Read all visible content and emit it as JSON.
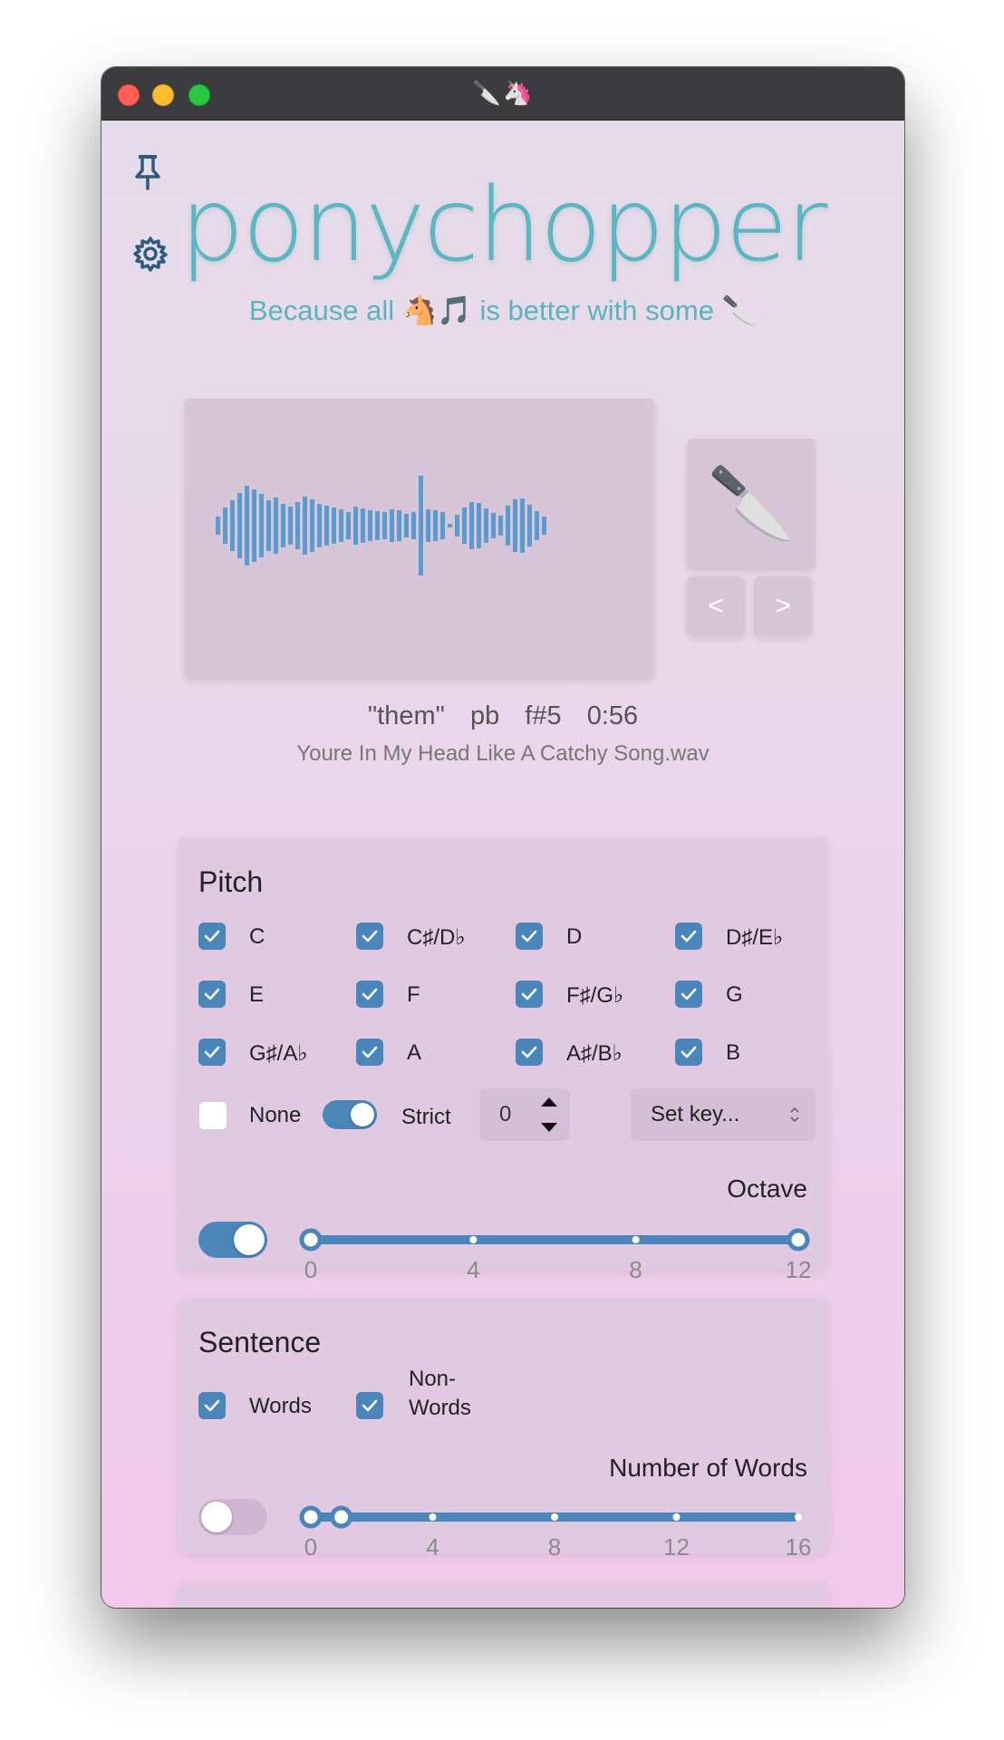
{
  "window": {
    "title_icons": "🔪🦄"
  },
  "sidebar": {
    "pin_icon": "pin-icon",
    "settings_icon": "gear-icon"
  },
  "header": {
    "logo": "ponychopper",
    "tagline": "Because all 🐴🎵 is better with some 🔪"
  },
  "player": {
    "knife_icon": "🔪",
    "prev_label": "<",
    "next_label": ">",
    "word": "\"them\"",
    "speaker": "pb",
    "note": "f#5",
    "time": "0:56",
    "filename": "Youre In My Head Like A Catchy Song.wav"
  },
  "pitch": {
    "title": "Pitch",
    "notes": [
      {
        "label": "C",
        "checked": true
      },
      {
        "label": "C♯/D♭",
        "checked": true
      },
      {
        "label": "D",
        "checked": true
      },
      {
        "label": "D♯/E♭",
        "checked": true
      },
      {
        "label": "E",
        "checked": true
      },
      {
        "label": "F",
        "checked": true
      },
      {
        "label": "F♯/G♭",
        "checked": true
      },
      {
        "label": "G",
        "checked": true
      },
      {
        "label": "G♯/A♭",
        "checked": true
      },
      {
        "label": "A",
        "checked": true
      },
      {
        "label": "A♯/B♭",
        "checked": true
      },
      {
        "label": "B",
        "checked": true
      }
    ],
    "none_label": "None",
    "none_checked": false,
    "strict_label": "Strict",
    "strict_on": true,
    "stepper_value": "0",
    "set_key_label": "Set key...",
    "octave": {
      "label": "Octave",
      "enabled": true,
      "range_min": 0,
      "range_max": 12,
      "selected_low": 0,
      "selected_high": 12,
      "ticks": [
        "0",
        "4",
        "8",
        "12"
      ]
    }
  },
  "sentence": {
    "title": "Sentence",
    "words_label": "Words",
    "words_checked": true,
    "nonwords_label": "Non-Words",
    "nonwords_line1": "Non-",
    "nonwords_line2": "Words",
    "nonwords_checked": true,
    "num_words": {
      "label": "Number of Words",
      "enabled": false,
      "range_min": 0,
      "range_max": 16,
      "selected_low": 0,
      "selected_high": 1,
      "ticks": [
        "0",
        "4",
        "8",
        "12",
        "16"
      ]
    }
  },
  "colors": {
    "accent": "#4a86ba",
    "logo": "#5bb6c2",
    "waveform": "#5a9bd0"
  }
}
